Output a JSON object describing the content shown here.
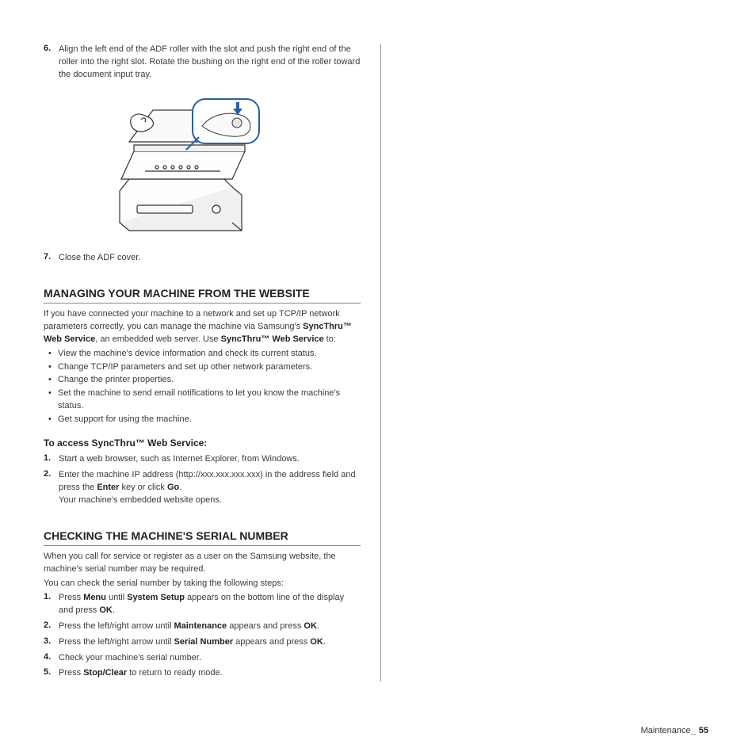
{
  "intro_step6": {
    "num": "6.",
    "text": "Align the left end of the ADF roller with the slot and push the right end of the roller into the right slot. Rotate the bushing on the right end of the roller toward the document input tray."
  },
  "intro_step7": {
    "num": "7.",
    "text": "Close the ADF cover."
  },
  "section1": {
    "title": "MANAGING YOUR MACHINE FROM THE WEBSITE",
    "p1a": "If you have connected your machine to a network and set up TCP/IP network parameters correctly, you can manage the machine via Samsung's ",
    "p1b": "SyncThru™ Web Service",
    "p1c": ", an embedded web server. Use ",
    "p1d": "SyncThru™ Web Service",
    "p1e": " to:",
    "b1": "View the machine's device information and check its current status.",
    "b2": "Change TCP/IP parameters and set up other network parameters.",
    "b3": "Change the printer properties.",
    "b4": "Set the machine to send email notifications to let you know the machine's status.",
    "b5": "Get support for using the machine.",
    "sub": "To access SyncThru™ Web Service:",
    "s1n": "1.",
    "s1": "Start a web browser, such as Internet Explorer, from Windows.",
    "s2n": "2.",
    "s2a": "Enter the machine IP address (http://xxx.xxx.xxx.xxx) in the address field and press the ",
    "s2b": "Enter",
    "s2c": " key or click ",
    "s2d": "Go",
    "s2e": ".",
    "s3": "Your machine's embedded website opens."
  },
  "section2": {
    "title": "CHECKING THE MACHINE'S SERIAL NUMBER",
    "p1": "When you call for service or register as a user on the Samsung website, the machine's serial number may be required.",
    "p2": "You can check the serial number by taking the following steps:",
    "s1n": "1.",
    "s1a": "Press ",
    "s1b": "Menu",
    "s1c": " until ",
    "s1d": "System Setup",
    "s1e": " appears on the bottom line of the display and press ",
    "s1f": "OK",
    "s1g": ".",
    "s2n": "2.",
    "s2a": "Press the left/right arrow until ",
    "s2b": "Maintenance",
    "s2c": " appears and press ",
    "s2d": "OK",
    "s2e": ".",
    "s3n": "3.",
    "s3a": "Press the left/right arrow until ",
    "s3b": "Serial Number",
    "s3c": " appears and press ",
    "s3d": "OK",
    "s3e": ".",
    "s4n": "4.",
    "s4": "Check your machine's serial number.",
    "s5n": "5.",
    "s5a": "Press ",
    "s5b": "Stop/Clear",
    "s5c": " to return to ready mode."
  },
  "footer": {
    "label": "Maintenance",
    "under": "_",
    "page": "55"
  }
}
